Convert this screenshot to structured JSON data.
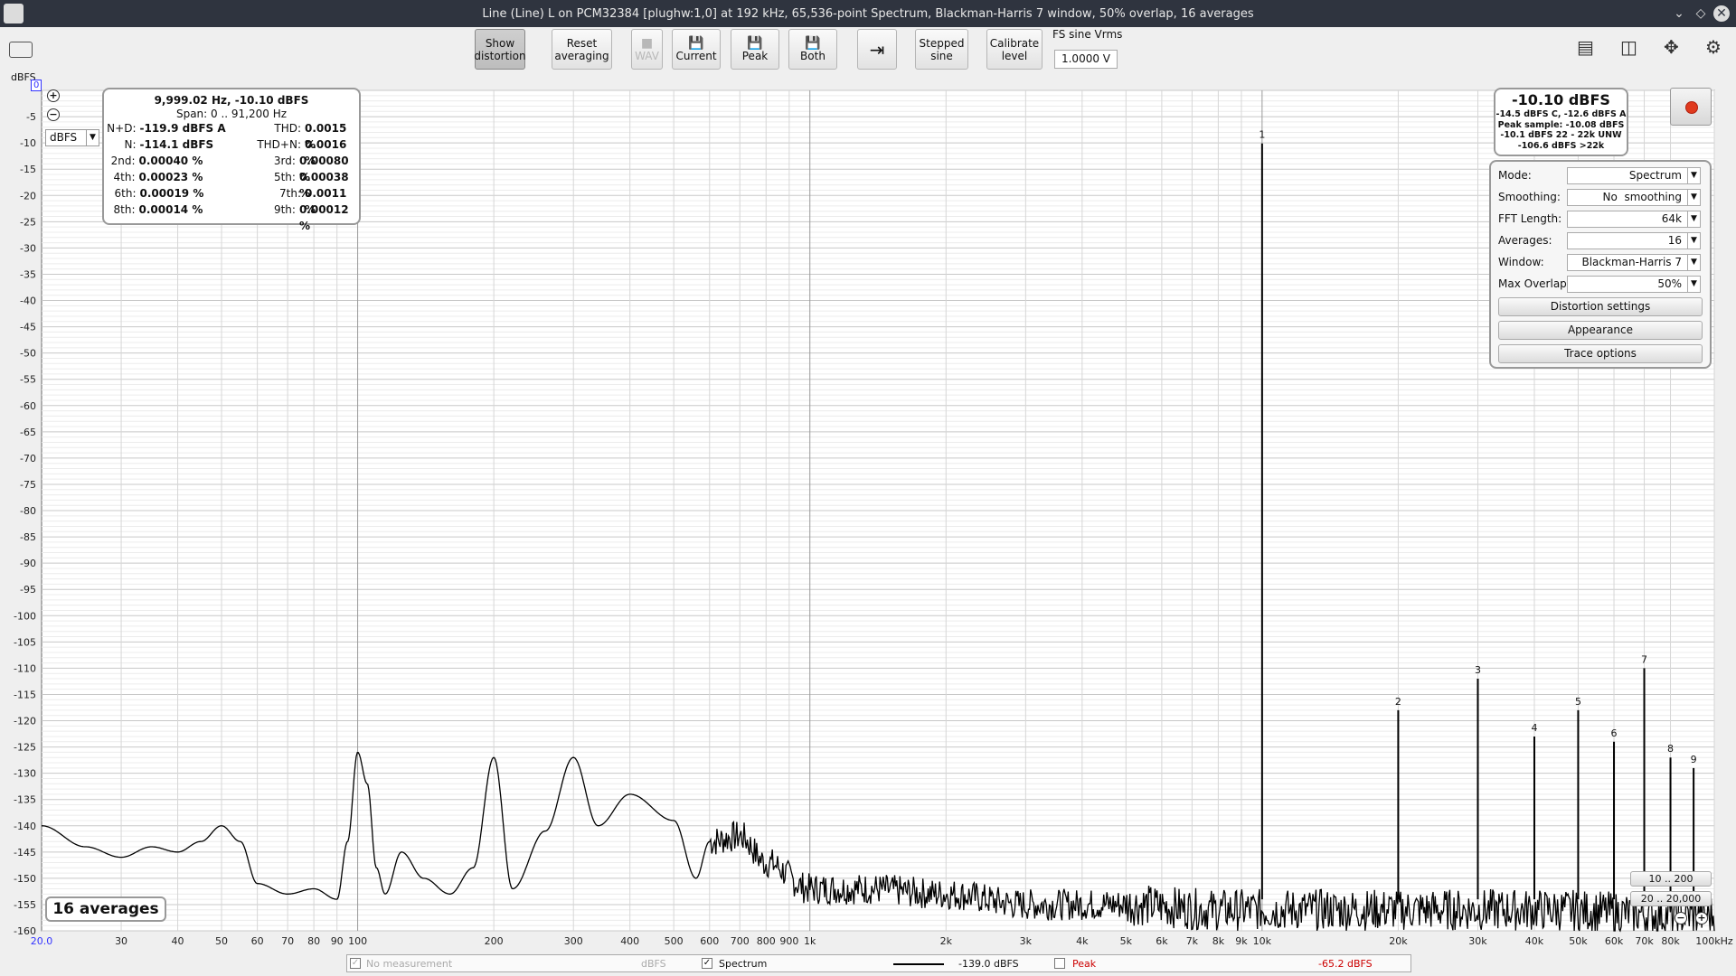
{
  "window": {
    "title": "Line (Line) L on PCM32384 [plughw:1,0] at 192 kHz, 65,536-point Spectrum, Blackman-Harris 7 window, 50% overlap, 16 averages",
    "controls": [
      "⌄",
      "◇",
      "✕"
    ]
  },
  "toolbar": {
    "show_distortion": "Show\ndistortion",
    "reset_averaging": "Reset\naveraging",
    "wav": "WAV",
    "current": "Current",
    "peak": "Peak",
    "both": "Both",
    "stepped_sine": "Stepped\nsine",
    "calibrate_level": "Calibrate\nlevel",
    "fs_sine_label": "FS sine Vrms",
    "fs_sine_value": "1.0000 V"
  },
  "readout": {
    "title": "9,999.02 Hz, -10.10 dBFS",
    "span": "Span: 0 .. 91,200 Hz",
    "rows": [
      {
        "l1": "N+D:",
        "v1": "-119.9 dBFS A",
        "l2": "THD:",
        "v2": "0.0015 %"
      },
      {
        "l1": "N:",
        "v1": "-114.1 dBFS",
        "l2": "THD+N:",
        "v2": "0.0016 %"
      },
      {
        "l1": "2nd:",
        "v1": "0.00040 %",
        "l2": "3rd:",
        "v2": "0.00080 %"
      },
      {
        "l1": "4th:",
        "v1": "0.00023 %",
        "l2": "5th:",
        "v2": "0.00038 %"
      },
      {
        "l1": "6th:",
        "v1": "0.00019 %",
        "l2": "7th:",
        "v2": "0.0011 %"
      },
      {
        "l1": "8th:",
        "v1": "0.00014 %",
        "l2": "9th:",
        "v2": "0.00012 %"
      }
    ]
  },
  "level": {
    "main": "-10.10 dBFS",
    "line1": "-14.5 dBFS C, -12.6 dBFS A",
    "line2": "Peak sample: -10.08 dBFS",
    "line3": "-10.1 dBFS 22 - 22k UNW",
    "line4": "-106.6 dBFS >22k"
  },
  "controls": {
    "mode_label": "Mode:",
    "mode_value": "Spectrum",
    "smoothing_label": "Smoothing:",
    "smoothing_value": "No  smoothing",
    "fft_label": "FFT Length:",
    "fft_value": "64k",
    "averages_label": "Averages:",
    "averages_value": "16",
    "window_label": "Window:",
    "window_value": "Blackman-Harris 7",
    "overlap_label": "Max Overlap:",
    "overlap_value": "50%",
    "distortion_settings": "Distortion settings",
    "appearance": "Appearance",
    "trace_options": "Trace options"
  },
  "unit_select": "dBFS",
  "averages_badge": "16 averages",
  "range_buttons": [
    "10 .. 200",
    "20 .. 20,000"
  ],
  "legend": {
    "no_measurement": "No measurement",
    "no_measurement_unit": "dBFS",
    "spectrum_label": "Spectrum",
    "spectrum_value": "-139.0 dBFS",
    "peak_label": "Peak",
    "peak_value": "-65.2 dBFS"
  },
  "chart_data": {
    "type": "line",
    "title": "",
    "xlabel": "",
    "ylabel": "dBFS",
    "x_scale": "log",
    "xlim": [
      20,
      100000
    ],
    "ylim": [
      -160,
      0
    ],
    "grid": true,
    "y_top_marker": "0",
    "x_left_marker": "20.0",
    "y_ticks": [
      "-5",
      "-10",
      "-15",
      "-20",
      "-25",
      "-30",
      "-35",
      "-40",
      "-45",
      "-50",
      "-55",
      "-60",
      "-65",
      "-70",
      "-75",
      "-80",
      "-85",
      "-90",
      "-95",
      "-100",
      "-105",
      "-110",
      "-115",
      "-120",
      "-125",
      "-130",
      "-135",
      "-140",
      "-145",
      "-150",
      "-155",
      "-160"
    ],
    "x_ticks": [
      {
        "v": 30,
        "t": "30"
      },
      {
        "v": 40,
        "t": "40"
      },
      {
        "v": 50,
        "t": "50"
      },
      {
        "v": 60,
        "t": "60"
      },
      {
        "v": 70,
        "t": "70"
      },
      {
        "v": 80,
        "t": "80"
      },
      {
        "v": 90,
        "t": "90"
      },
      {
        "v": 100,
        "t": "100"
      },
      {
        "v": 200,
        "t": "200"
      },
      {
        "v": 300,
        "t": "300"
      },
      {
        "v": 400,
        "t": "400"
      },
      {
        "v": 500,
        "t": "500"
      },
      {
        "v": 600,
        "t": "600"
      },
      {
        "v": 700,
        "t": "700"
      },
      {
        "v": 800,
        "t": "800"
      },
      {
        "v": 900,
        "t": "900"
      },
      {
        "v": 1000,
        "t": "1k"
      },
      {
        "v": 2000,
        "t": "2k"
      },
      {
        "v": 3000,
        "t": "3k"
      },
      {
        "v": 4000,
        "t": "4k"
      },
      {
        "v": 5000,
        "t": "5k"
      },
      {
        "v": 6000,
        "t": "6k"
      },
      {
        "v": 7000,
        "t": "7k"
      },
      {
        "v": 8000,
        "t": "8k"
      },
      {
        "v": 9000,
        "t": "9k"
      },
      {
        "v": 10000,
        "t": "10k"
      },
      {
        "v": 20000,
        "t": "20k"
      },
      {
        "v": 30000,
        "t": "30k"
      },
      {
        "v": 40000,
        "t": "40k"
      },
      {
        "v": 50000,
        "t": "50k"
      },
      {
        "v": 60000,
        "t": "60k"
      },
      {
        "v": 70000,
        "t": "70k"
      },
      {
        "v": 80000,
        "t": "80k"
      },
      {
        "v": 100000,
        "t": "100kHz"
      }
    ],
    "series": [
      {
        "name": "Spectrum",
        "x": [
          20,
          25,
          30,
          35,
          40,
          45,
          50,
          55,
          60,
          70,
          80,
          90,
          95,
          100,
          105,
          110,
          115,
          125,
          140,
          160,
          180,
          200,
          220,
          260,
          300,
          340,
          400,
          500,
          560,
          600,
          700,
          800,
          1000,
          1300,
          2000,
          3000,
          5000,
          8000,
          10000,
          20000,
          40000,
          90000,
          100000
        ],
        "y": [
          -140,
          -144,
          -146,
          -144,
          -145,
          -143,
          -140,
          -143,
          -151,
          -153,
          -152,
          -154,
          -143,
          -126,
          -132,
          -148,
          -153,
          -145,
          -150,
          -153,
          -148,
          -127,
          -152,
          -141,
          -127,
          -140,
          -134,
          -139,
          -150,
          -143,
          -142,
          -147,
          -152,
          -152,
          -153,
          -155,
          -155,
          -156,
          -156,
          -156,
          -156,
          -157,
          -157
        ]
      }
    ],
    "peaks": [
      {
        "label": "1",
        "x": 10000,
        "y": -10.1
      },
      {
        "label": "2",
        "x": 20000,
        "y": -118
      },
      {
        "label": "3",
        "x": 30000,
        "y": -112
      },
      {
        "label": "4",
        "x": 40000,
        "y": -123
      },
      {
        "label": "5",
        "x": 50000,
        "y": -118
      },
      {
        "label": "6",
        "x": 60000,
        "y": -124
      },
      {
        "label": "7",
        "x": 70000,
        "y": -110
      },
      {
        "label": "8",
        "x": 80000,
        "y": -127
      },
      {
        "label": "9",
        "x": 90000,
        "y": -129
      }
    ],
    "colors": {
      "trace": "#000000",
      "grid": "#d6d6d6",
      "major_grid": "#9a9a9a",
      "background": "#ffffff"
    }
  }
}
